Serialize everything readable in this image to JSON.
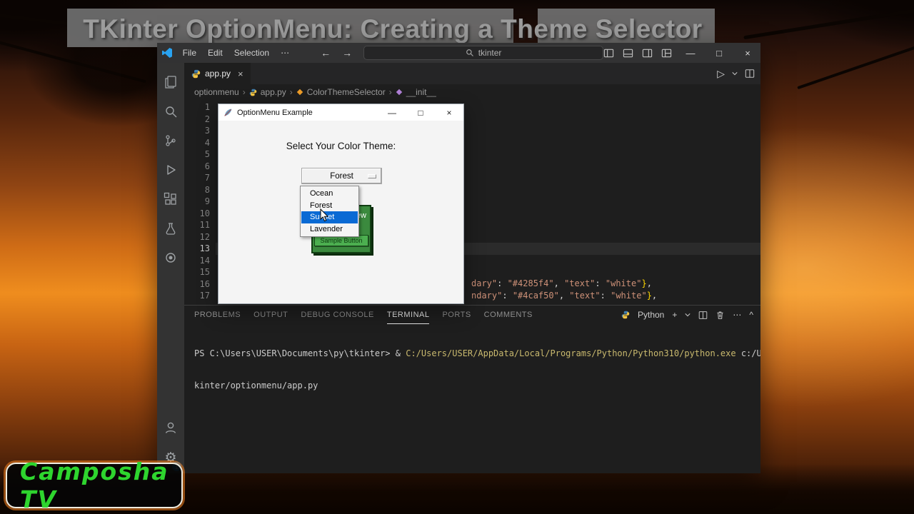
{
  "overlay": {
    "video_title": "TKinter OptionMenu: Creating a Theme Selector",
    "watermark": "Camposha TV"
  },
  "colors": {
    "selection_blue": "#0a6ad4",
    "preview_green": "#3b8a3e",
    "sample_button_green": "#4caf50",
    "badge_blue": "#0e7ad3",
    "watermark_green": "#2ed52e",
    "code_string_orange": "#ce9178",
    "terminal_command_yellow": "#c9b96e"
  },
  "icons": {
    "minimize": "—",
    "maximize": "□",
    "close": "×",
    "back": "←",
    "forward": "→",
    "run": "▷",
    "ellipsis": "⋯",
    "crumb_sep": "›",
    "plus": "+",
    "caret_up": "^",
    "gear": "⚙"
  },
  "vscode": {
    "titlebar": {
      "menus": [
        "File",
        "Edit",
        "Selection",
        "⋯"
      ],
      "search_value": "tkinter"
    },
    "tab": {
      "label": "app.py"
    },
    "breadcrumbs": [
      "optionmenu",
      "app.py",
      "ColorThemeSelector",
      "__init__"
    ],
    "editor": {
      "line_numbers": [
        {
          "n": 1
        },
        {
          "n": 2
        },
        {
          "n": 3
        },
        {
          "n": 4
        },
        {
          "n": 5
        },
        {
          "n": 6
        },
        {
          "n": 7
        },
        {
          "n": 8
        },
        {
          "n": 9
        },
        {
          "n": 10
        },
        {
          "n": 11
        },
        {
          "n": 12
        },
        {
          "n": 13,
          "state": "current"
        },
        {
          "n": 14
        },
        {
          "n": 15
        },
        {
          "n": 16
        },
        {
          "n": 17
        }
      ],
      "code_line_16": {
        "segments": [
          {
            "t": "dary\"",
            "c": "s"
          },
          {
            "t": ": ",
            "c": "p"
          },
          {
            "t": "\"#4285f4\"",
            "c": "s"
          },
          {
            "t": ", ",
            "c": "p"
          },
          {
            "t": "\"text\"",
            "c": "s"
          },
          {
            "t": ": ",
            "c": "p"
          },
          {
            "t": "\"white\"",
            "c": "s"
          },
          {
            "t": "}",
            "c": "b"
          },
          {
            "t": ",",
            "c": "p"
          }
        ]
      },
      "code_line_17": {
        "segments": [
          {
            "t": "ndary\"",
            "c": "s"
          },
          {
            "t": ": ",
            "c": "p"
          },
          {
            "t": "\"#4caf50\"",
            "c": "s"
          },
          {
            "t": ", ",
            "c": "p"
          },
          {
            "t": "\"text\"",
            "c": "s"
          },
          {
            "t": ": ",
            "c": "p"
          },
          {
            "t": "\"white\"",
            "c": "s"
          },
          {
            "t": "}",
            "c": "b"
          },
          {
            "t": ",",
            "c": "p"
          }
        ]
      }
    },
    "panel": {
      "tabs": [
        {
          "label": "PROBLEMS"
        },
        {
          "label": "OUTPUT"
        },
        {
          "label": "DEBUG CONSOLE"
        },
        {
          "label": "TERMINAL",
          "state": "active"
        },
        {
          "label": "PORTS"
        },
        {
          "label": "COMMENTS"
        }
      ],
      "shell_label": "Python",
      "terminal_lines": [
        {
          "segments": [
            {
              "t": "PS C:\\Users\\USER\\Documents\\py\\tkinter> ",
              "c": "t-plain"
            },
            {
              "t": "& ",
              "c": "t-plain"
            },
            {
              "t": "C:/Users/USER/AppData/Local/Programs/Python/Python310/python.exe",
              "c": "t-cmd"
            },
            {
              "t": " c:/Users/USER/Documents/py/t",
              "c": "t-plain"
            }
          ]
        },
        {
          "segments": [
            {
              "t": "kinter/optionmenu/app.py",
              "c": "t-plain"
            }
          ]
        }
      ]
    }
  },
  "tk_window": {
    "title": "OptionMenu Example",
    "prompt_label": "Select Your Color Theme:",
    "selected_theme": "Forest",
    "dropdown_items": [
      {
        "label": "Ocean"
      },
      {
        "label": "Forest"
      },
      {
        "label": "Sunset",
        "state": "selected"
      },
      {
        "label": "Lavender"
      }
    ],
    "preview_label": "Preview",
    "sample_button_label": "Sample Button"
  }
}
